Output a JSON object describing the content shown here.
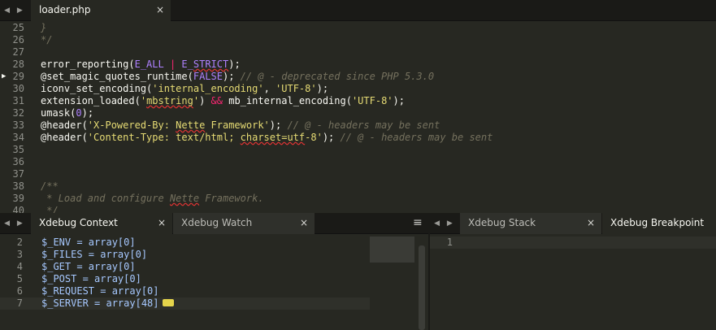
{
  "top_tabs": [
    {
      "label": "loader.php",
      "close": "×"
    }
  ],
  "tab_nav_arrows": "◀ ▶",
  "editor_lines": [
    {
      "num": "25",
      "tokens": [
        {
          "t": "}",
          "c": "c-comment"
        }
      ]
    },
    {
      "num": "26",
      "tokens": [
        {
          "t": "*/",
          "c": "c-comment"
        }
      ]
    },
    {
      "num": "27",
      "tokens": []
    },
    {
      "num": "28",
      "tokens": [
        {
          "t": "error_reporting("
        },
        {
          "t": "E_ALL",
          "c": "c-purple"
        },
        {
          "t": " "
        },
        {
          "t": "|",
          "c": "c-pink"
        },
        {
          "t": " "
        },
        {
          "t": "E_",
          "c": "c-purple"
        },
        {
          "t": "STRICT",
          "c": "c-purple sq"
        },
        {
          "t": ");"
        }
      ]
    },
    {
      "num": "29",
      "marker": "▶",
      "tokens": [
        {
          "t": "@set_magic_quotes_runtime("
        },
        {
          "t": "FALSE",
          "c": "c-purple"
        },
        {
          "t": "); "
        },
        {
          "t": "// @ - deprecated since PHP 5.3.0",
          "c": "c-comment"
        }
      ]
    },
    {
      "num": "30",
      "tokens": [
        {
          "t": "iconv_set_encoding("
        },
        {
          "t": "'internal_encoding'",
          "c": "c-yellow"
        },
        {
          "t": ", "
        },
        {
          "t": "'UTF-8'",
          "c": "c-yellow"
        },
        {
          "t": ");"
        }
      ]
    },
    {
      "num": "31",
      "tokens": [
        {
          "t": "extension_loaded("
        },
        {
          "t": "'",
          "c": "c-yellow"
        },
        {
          "t": "mbstring",
          "c": "c-yellow sq"
        },
        {
          "t": "'",
          "c": "c-yellow"
        },
        {
          "t": ") "
        },
        {
          "t": "&&",
          "c": "c-pink"
        },
        {
          "t": " mb_internal_encoding("
        },
        {
          "t": "'UTF-8'",
          "c": "c-yellow"
        },
        {
          "t": ");"
        }
      ]
    },
    {
      "num": "32",
      "tokens": [
        {
          "t": "umask("
        },
        {
          "t": "0",
          "c": "c-purple"
        },
        {
          "t": ");"
        }
      ]
    },
    {
      "num": "33",
      "tokens": [
        {
          "t": "@header("
        },
        {
          "t": "'X-Powered-By: ",
          "c": "c-yellow"
        },
        {
          "t": "Nette",
          "c": "c-yellow sq"
        },
        {
          "t": " Framework'",
          "c": "c-yellow"
        },
        {
          "t": "); "
        },
        {
          "t": "// @ - headers may be sent",
          "c": "c-comment"
        }
      ]
    },
    {
      "num": "34",
      "tokens": [
        {
          "t": "@header("
        },
        {
          "t": "'Content-Type: text/html; ",
          "c": "c-yellow"
        },
        {
          "t": "charset=utf",
          "c": "c-yellow sq"
        },
        {
          "t": "-8'",
          "c": "c-yellow"
        },
        {
          "t": "); "
        },
        {
          "t": "// @ - headers may be sent",
          "c": "c-comment"
        }
      ]
    },
    {
      "num": "35",
      "tokens": []
    },
    {
      "num": "36",
      "tokens": []
    },
    {
      "num": "37",
      "tokens": []
    },
    {
      "num": "38",
      "tokens": [
        {
          "t": "/**",
          "c": "c-comment"
        }
      ]
    },
    {
      "num": "39",
      "tokens": [
        {
          "t": " * Load and configure ",
          "c": "c-comment"
        },
        {
          "t": "Nette",
          "c": "c-comment sq"
        },
        {
          "t": " Framework.",
          "c": "c-comment"
        }
      ]
    },
    {
      "num": "40",
      "tokens": [
        {
          "t": " */",
          "c": "c-comment"
        }
      ]
    }
  ],
  "left_panel": {
    "tabs": [
      {
        "label": "Xdebug Context",
        "close": "×"
      },
      {
        "label": "Xdebug Watch",
        "close": "×"
      }
    ],
    "menu_icon": "≡",
    "lines": [
      {
        "num": "2",
        "text": "$_ENV = array[0]"
      },
      {
        "num": "3",
        "text": "$_FILES = array[0]"
      },
      {
        "num": "4",
        "text": "$_GET = array[0]"
      },
      {
        "num": "5",
        "text": "$_POST = array[0]"
      },
      {
        "num": "6",
        "text": "$_REQUEST = array[0]"
      },
      {
        "num": "7",
        "text": "$_SERVER = array[48]"
      }
    ]
  },
  "right_panel": {
    "tabs": [
      {
        "label": "Xdebug Stack",
        "close": "×"
      },
      {
        "label": "Xdebug Breakpoint"
      }
    ],
    "lines": [
      {
        "num": "1",
        "text": ""
      }
    ]
  },
  "colors": {
    "background": "#272822",
    "tabbar": "#1a1a17",
    "keyword": "#f92672",
    "string": "#e6db74",
    "constant": "#ae81ff",
    "comment": "#75715e"
  }
}
